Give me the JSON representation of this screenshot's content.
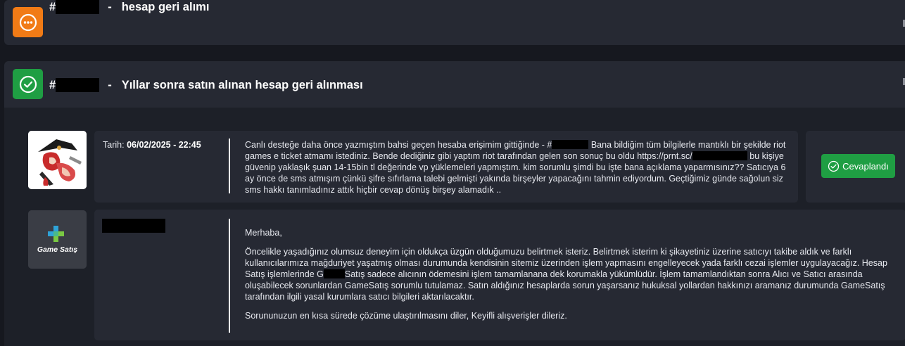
{
  "tickets": [
    {
      "id_prefix": "#",
      "separator": "-",
      "title": "hesap geri alımı",
      "status": "pending",
      "status_color": "#f17b16",
      "status_icon": "ellipsis-circle-icon"
    },
    {
      "id_prefix": "#",
      "separator": "-",
      "title": "Yıllar sonra satın alınan hesap geri alınması",
      "status": "answered",
      "status_color": "#1f9e43",
      "status_icon": "check-circle-icon"
    }
  ],
  "messages": [
    {
      "date_label": "Tarih:",
      "date_value": "06/02/2025 - 22:45",
      "text_1": "Canlı desteğe daha önce yazmıştım bahsi geçen hesaba erişimim gittiğinde - #",
      "text_2": " Bana bildiğim tüm bilgilerle mantıklı bir şekilde riot games e ticket atmamı istediniz. Bende dediğiniz gibi yaptım riot tarafından gelen son sonuç bu oldu https://prnt.sc/",
      "text_3": " bu kişiye güvenip yaklaşık şuan 14-15bin tl değerinde vp yüklemeleri yapmıştım. kim sorumlu şimdi bu işte bana açıklama yaparmısınız?? Satıcıya 6 ay önce de sms atmışım çünkü şifre sıfırlama talebi gelmişti yakında birşeyler yapacağını tahmin ediyordum. Geçtiğimiz günde sağolun siz sms hakkı tanımladınız attık hiçbir cevap dönüş birşey alamadık .."
    },
    {
      "greeting": "Merhaba,",
      "para_1_a": "Öncelikle yaşadığınız olumsuz deneyim için oldukça üzgün olduğumuzu belirtmek isteriz.  Belirtmek isterim ki şikayetiniz üzerine satıcıyı takibe aldık ve farklı kullanıcılarımıza mağduriyet yaşatmış olması durumunda kendisinin sitemiz üzerinden işlem yapmasını engelleyecek yada farklı cezai işlemler uygulayacağız.  Hesap Satış işlemlerinde G",
      "para_1_b": "Satış sadece alıcının ödemesini işlem tamamlanana dek korumakla yükümlüdür. İşlem tamamlandıktan sonra Alıcı ve Satıcı arasında oluşabilecek sorunlardan GameSatış sorumlu tutulamaz. Satın aldığınız hesaplarda sorun yaşarsanız hukuksal yollardan hakkınızı aramanız durumunda GameSatış tarafından ilgili yasal kurumlara satıcı bilgileri aktarılacaktır.",
      "closing": "Sorununuzun en kısa sürede çözüme ulaştırılmasını diler, Keyifli alışverişler dileriz."
    }
  ],
  "logo": {
    "text": "Game Satış",
    "icon": "plus-logo-icon"
  },
  "status_button": {
    "label": "Cevaplandı",
    "icon": "check-circle-icon"
  }
}
